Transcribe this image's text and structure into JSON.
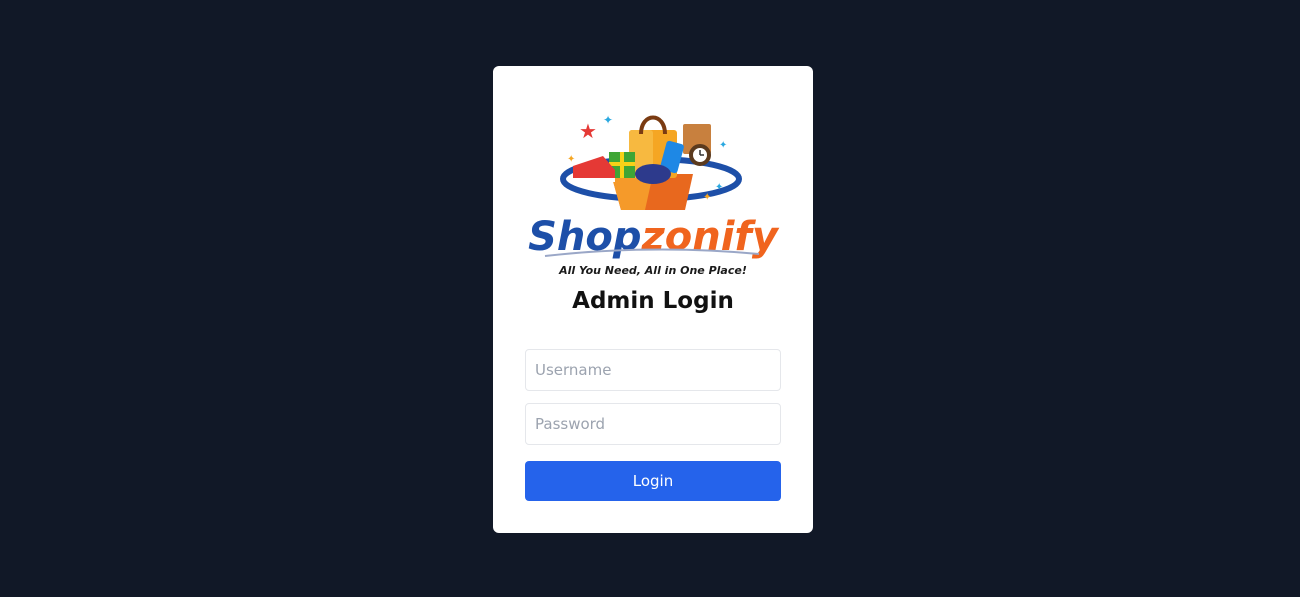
{
  "logo": {
    "brand_part1": "Shop",
    "brand_part2": "zonify",
    "tagline": "All You Need, All in One Place!"
  },
  "login": {
    "title": "Admin Login",
    "username_placeholder": "Username",
    "password_placeholder": "Password",
    "button_label": "Login"
  },
  "colors": {
    "background": "#111827",
    "card": "#ffffff",
    "button": "#2563eb",
    "brand_blue": "#1d4fa8",
    "brand_orange": "#f0641e"
  }
}
